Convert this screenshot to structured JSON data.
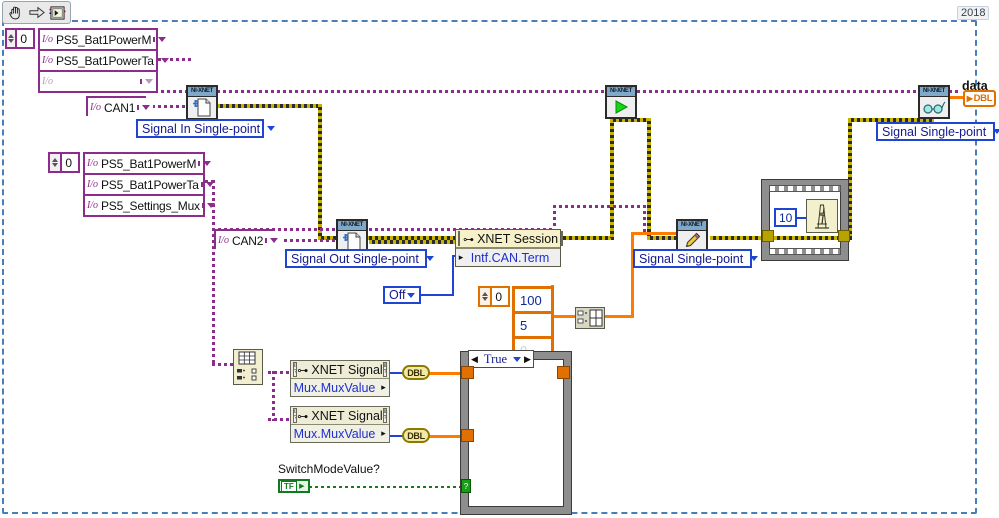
{
  "window": {
    "version_label": "2018",
    "toolbar": {
      "items": [
        {
          "name": "pan-tool",
          "glyph": "✋"
        },
        {
          "name": "select-arrow-tool",
          "glyph": "⇨"
        },
        {
          "name": "run-vi-button",
          "glyph": "▶"
        }
      ]
    }
  },
  "constants": {
    "index_top": "0",
    "index_mid": "0",
    "index_array_orange": "0",
    "wait_ms": "10",
    "term_off": "Off"
  },
  "signal_list_top": {
    "rows": [
      {
        "label": "PS5_Bat1PowerM",
        "dimmed": false
      },
      {
        "label": "PS5_Bat1PowerTa",
        "dimmed": false
      },
      {
        "label": "",
        "dimmed": true
      }
    ]
  },
  "signal_list_mid": {
    "rows": [
      {
        "label": "PS5_Bat1PowerM",
        "dimmed": false
      },
      {
        "label": "PS5_Bat1PowerTa",
        "dimmed": false
      },
      {
        "label": "PS5_Settings_Mux",
        "dimmed": false
      }
    ]
  },
  "interfaces": {
    "can1": "CAN1",
    "can2": "CAN2"
  },
  "mode_selectors": {
    "signal_in_single_point": "Signal In Single-point",
    "signal_out_single_point": "Signal Out Single-point",
    "signal_single_point_write": "Signal Single-point",
    "signal_single_point_read": "Signal Single-point"
  },
  "property_nodes": {
    "xnet_session": {
      "title": "XNET Session",
      "property": "Intf.CAN.Term"
    },
    "xnet_signal_1": {
      "title": "XNET Signal",
      "property": "Mux.MuxValue"
    },
    "xnet_signal_2": {
      "title": "XNET Signal",
      "property": "Mux.MuxValue"
    }
  },
  "xnet_vis": {
    "create_session_in": "NI-XNET",
    "create_session_out": "NI-XNET",
    "start": "NI-XNET",
    "write": "NI-XNET",
    "read": "NI-XNET"
  },
  "array_constant": {
    "values": [
      "100",
      "5",
      "0"
    ],
    "dimmed_index": 2
  },
  "case_structure": {
    "selected_case": "True",
    "left_arrow": "◀",
    "right_arrow": "▶"
  },
  "boolean_control": {
    "label": "SwitchModeValue?",
    "state": "TF"
  },
  "indicators": {
    "data_label": "data",
    "data_type": "DBL"
  },
  "coercion_chips": {
    "dbl_1": "DBL",
    "dbl_2": "DBL"
  },
  "colors": {
    "wire_xnet_purple": "#8c2d8c",
    "wire_session_yellow": "#c8b400",
    "wire_numeric_orange": "#ff7b00",
    "wire_boolean_green": "#1a7a1a",
    "wire_enum_blue": "#1e46d2",
    "structure_grey": "#8e8e8e",
    "diagram_border_blue": "#4a7ebb"
  }
}
